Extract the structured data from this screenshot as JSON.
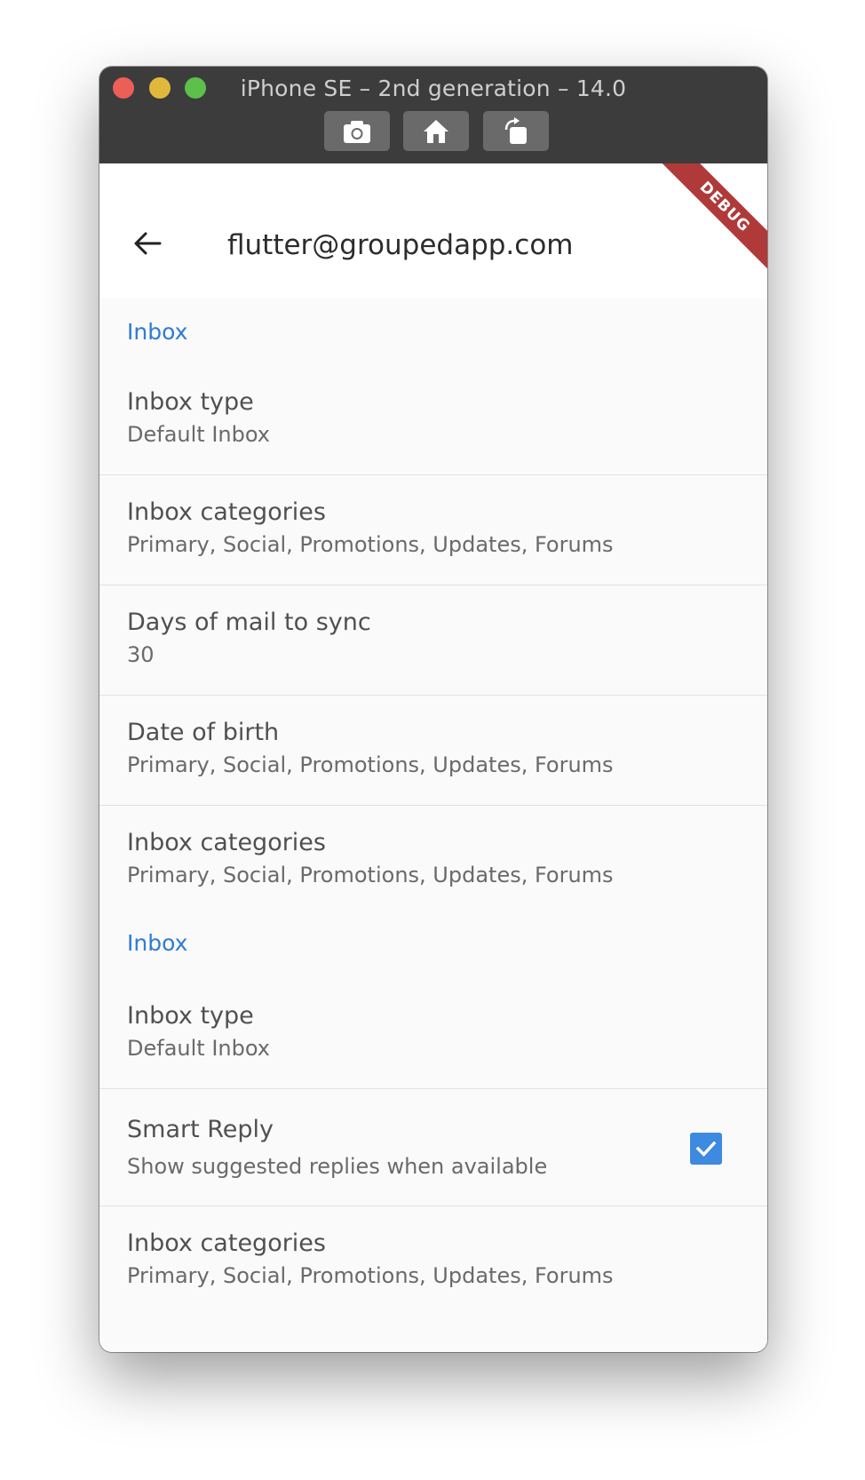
{
  "window": {
    "title": "iPhone SE – 2nd generation – 14.0",
    "toolbar_icons": [
      "screenshot-icon",
      "home-icon",
      "rotate-icon"
    ]
  },
  "appbar": {
    "title": "flutter@groupedapp.com",
    "debug_label": "DEBUG"
  },
  "sections": [
    {
      "header": "Inbox",
      "tiles": [
        {
          "title": "Inbox type",
          "subtitle": "Default Inbox"
        },
        {
          "title": "Inbox categories",
          "subtitle": "Primary, Social, Promotions, Updates, Forums"
        },
        {
          "title": "Days of mail to sync",
          "subtitle": "30"
        },
        {
          "title": "Date of birth",
          "subtitle": "Primary, Social, Promotions, Updates, Forums"
        },
        {
          "title": "Inbox categories",
          "subtitle": "Primary, Social, Promotions, Updates, Forums"
        }
      ]
    },
    {
      "header": "Inbox",
      "tiles": [
        {
          "title": "Inbox type",
          "subtitle": "Default Inbox"
        },
        {
          "title": "Smart Reply",
          "subtitle": "Show suggested replies when available",
          "checked": true
        },
        {
          "title": "Inbox categories",
          "subtitle": "Primary, Social, Promotions, Updates, Forums"
        }
      ]
    }
  ],
  "colors": {
    "accent": "#2e7bd6",
    "checkbox": "#3d8ae0",
    "debug_banner": "#b03a3a"
  }
}
